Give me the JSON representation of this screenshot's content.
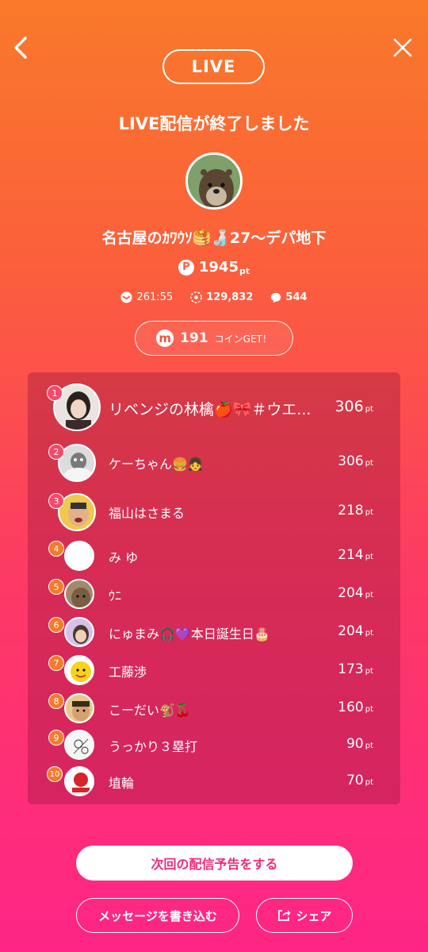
{
  "header": {
    "live_label": "LIVE",
    "ended_message": "LIVE配信が終了しました"
  },
  "streamer": {
    "name": "名古屋のｶﾜｳｿ🥞🍶27〜デパ地下",
    "points": "1945",
    "points_unit": "pt",
    "points_icon": "P"
  },
  "stats": {
    "duration": "261:55",
    "views": "129,832",
    "comments": "544"
  },
  "coin": {
    "icon": "m",
    "value": "191",
    "label": "コインGET！"
  },
  "ranking": [
    {
      "rank": "1",
      "name": "リベンジの林檎🍎🎀＃ウエ...",
      "points": "306",
      "unit": "pt",
      "badge_color": "#f24a6a"
    },
    {
      "rank": "2",
      "name": "ケーちゃん🍔👧",
      "points": "306",
      "unit": "pt",
      "badge_color": "#f24a6a"
    },
    {
      "rank": "3",
      "name": "福山はさまる",
      "points": "218",
      "unit": "pt",
      "badge_color": "#f24a6a"
    },
    {
      "rank": "4",
      "name": "み ゆ",
      "points": "214",
      "unit": "pt",
      "badge_color": "#f57a2a"
    },
    {
      "rank": "5",
      "name": "ｳﾆ",
      "points": "204",
      "unit": "pt",
      "badge_color": "#f57a2a"
    },
    {
      "rank": "6",
      "name": "にゅまみ🎧💜本日誕生日🎂",
      "points": "204",
      "unit": "pt",
      "badge_color": "#f57a2a"
    },
    {
      "rank": "7",
      "name": "工藤渉",
      "points": "173",
      "unit": "pt",
      "badge_color": "#f57a2a"
    },
    {
      "rank": "8",
      "name": "こーだい🐒🍒",
      "points": "160",
      "unit": "pt",
      "badge_color": "#f57a2a"
    },
    {
      "rank": "9",
      "name": "うっかり３塁打",
      "points": "90",
      "unit": "pt",
      "badge_color": "#f57a2a"
    },
    {
      "rank": "10",
      "name": "埴輪",
      "points": "70",
      "unit": "pt",
      "badge_color": "#f57a2a"
    }
  ],
  "actions": {
    "schedule_label": "次回の配信予告をする",
    "message_label": "メッセージを書き込む",
    "share_label": "シェア"
  }
}
